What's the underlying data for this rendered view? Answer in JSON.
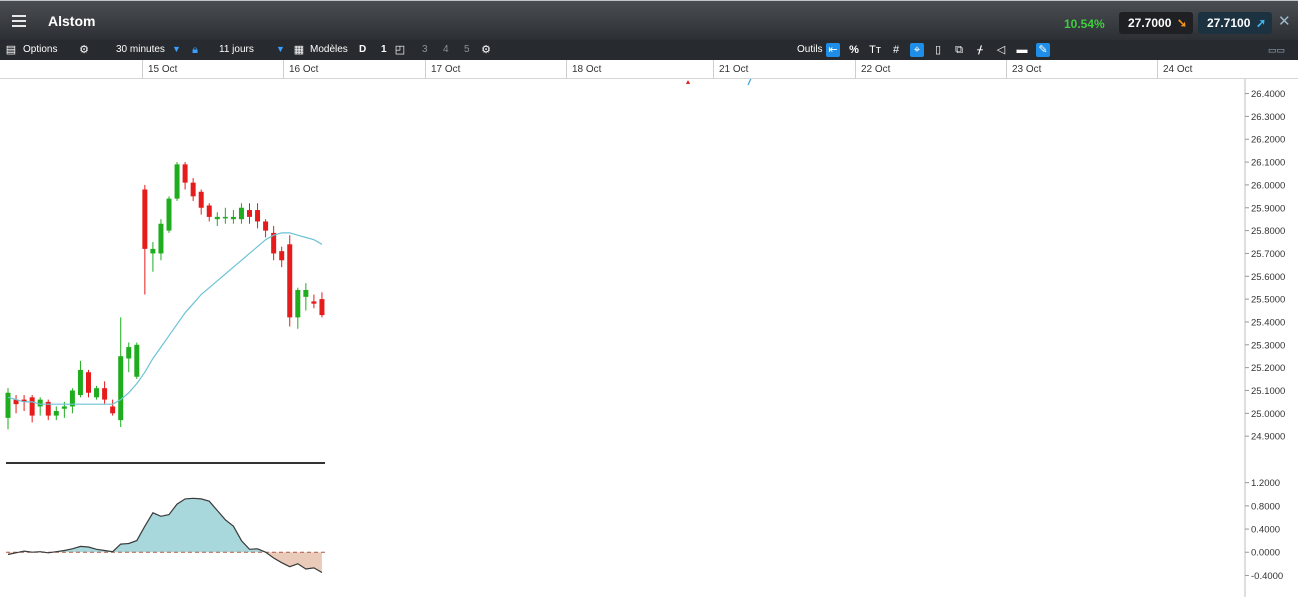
{
  "header": {
    "title": "Alstom",
    "change_pct": "10.54%",
    "bid": "27.7000",
    "ask": "27.7100"
  },
  "toolbar": {
    "options_label": "Options",
    "interval": "30 minutes",
    "range": "11 jours",
    "models_label": "Modèles",
    "d_label": "D",
    "n1": "1",
    "n3": "3",
    "n4": "4",
    "n5": "5",
    "tools_label": "Outils"
  },
  "dates": [
    "15 Oct",
    "16 Oct",
    "17 Oct",
    "18 Oct",
    "21 Oct",
    "22 Oct",
    "23 Oct",
    "24 Oct"
  ],
  "colors": {
    "up": "#1fad1f",
    "down": "#e61c1c",
    "ma": "#6cc3d6",
    "osc_pos": "#a8d8dc",
    "osc_neg": "#eacbb9"
  },
  "chart_data": {
    "type": "candlestick",
    "price_axis": {
      "ticks": [
        "26.4000",
        "26.3000",
        "26.2000",
        "26.1000",
        "26.0000",
        "25.9000",
        "25.8000",
        "25.7000",
        "25.6000",
        "25.5000",
        "25.4000",
        "25.3000",
        "25.2000",
        "25.1000",
        "25.0000",
        "24.9000"
      ],
      "ylim": [
        24.87,
        26.42
      ]
    },
    "osc_axis": {
      "ticks": [
        "1.2000",
        "0.8000",
        "0.4000",
        "0.0000",
        "-0.4000"
      ],
      "ylim": [
        -0.6,
        1.35
      ]
    },
    "candles": [
      {
        "o": 24.98,
        "h": 25.11,
        "l": 24.93,
        "c": 25.09
      },
      {
        "o": 25.06,
        "h": 25.08,
        "l": 25.0,
        "c": 25.04
      },
      {
        "o": 25.06,
        "h": 25.08,
        "l": 25.01,
        "c": 25.05
      },
      {
        "o": 25.07,
        "h": 25.08,
        "l": 24.96,
        "c": 24.99
      },
      {
        "o": 25.03,
        "h": 25.07,
        "l": 24.99,
        "c": 25.06
      },
      {
        "o": 25.05,
        "h": 25.06,
        "l": 24.97,
        "c": 24.99
      },
      {
        "o": 24.99,
        "h": 25.03,
        "l": 24.97,
        "c": 25.01
      },
      {
        "o": 25.02,
        "h": 25.05,
        "l": 24.98,
        "c": 25.03
      },
      {
        "o": 25.03,
        "h": 25.11,
        "l": 25.0,
        "c": 25.1
      },
      {
        "o": 25.08,
        "h": 25.23,
        "l": 25.07,
        "c": 25.19
      },
      {
        "o": 25.18,
        "h": 25.19,
        "l": 25.07,
        "c": 25.09
      },
      {
        "o": 25.07,
        "h": 25.12,
        "l": 25.06,
        "c": 25.11
      },
      {
        "o": 25.11,
        "h": 25.14,
        "l": 25.04,
        "c": 25.06
      },
      {
        "o": 25.03,
        "h": 25.06,
        "l": 24.99,
        "c": 25.0
      },
      {
        "o": 24.97,
        "h": 25.42,
        "l": 24.94,
        "c": 25.25
      },
      {
        "o": 25.24,
        "h": 25.31,
        "l": 25.18,
        "c": 25.29
      },
      {
        "o": 25.16,
        "h": 25.31,
        "l": 25.15,
        "c": 25.3
      },
      {
        "o": 25.98,
        "h": 26.0,
        "l": 25.52,
        "c": 25.72
      },
      {
        "o": 25.7,
        "h": 25.75,
        "l": 25.62,
        "c": 25.72
      },
      {
        "o": 25.7,
        "h": 25.85,
        "l": 25.67,
        "c": 25.83
      },
      {
        "o": 25.8,
        "h": 25.95,
        "l": 25.79,
        "c": 25.94
      },
      {
        "o": 25.94,
        "h": 26.1,
        "l": 25.93,
        "c": 26.09
      },
      {
        "o": 26.09,
        "h": 26.1,
        "l": 25.98,
        "c": 26.01
      },
      {
        "o": 26.01,
        "h": 26.03,
        "l": 25.93,
        "c": 25.95
      },
      {
        "o": 25.97,
        "h": 25.98,
        "l": 25.87,
        "c": 25.9
      },
      {
        "o": 25.91,
        "h": 25.92,
        "l": 25.84,
        "c": 25.86
      },
      {
        "o": 25.85,
        "h": 25.88,
        "l": 25.82,
        "c": 25.86
      },
      {
        "o": 25.86,
        "h": 25.9,
        "l": 25.83,
        "c": 25.86
      },
      {
        "o": 25.85,
        "h": 25.89,
        "l": 25.83,
        "c": 25.86
      },
      {
        "o": 25.85,
        "h": 25.92,
        "l": 25.83,
        "c": 25.9
      },
      {
        "o": 25.89,
        "h": 25.92,
        "l": 25.83,
        "c": 25.86
      },
      {
        "o": 25.89,
        "h": 25.92,
        "l": 25.81,
        "c": 25.84
      },
      {
        "o": 25.84,
        "h": 25.85,
        "l": 25.77,
        "c": 25.8
      },
      {
        "o": 25.79,
        "h": 25.82,
        "l": 25.67,
        "c": 25.7
      },
      {
        "o": 25.71,
        "h": 25.73,
        "l": 25.64,
        "c": 25.67
      },
      {
        "o": 25.74,
        "h": 25.78,
        "l": 25.38,
        "c": 25.42
      },
      {
        "o": 25.42,
        "h": 25.55,
        "l": 25.37,
        "c": 25.54
      },
      {
        "o": 25.51,
        "h": 25.57,
        "l": 25.45,
        "c": 25.54
      },
      {
        "o": 25.49,
        "h": 25.52,
        "l": 25.46,
        "c": 25.48
      },
      {
        "o": 25.5,
        "h": 25.53,
        "l": 25.42,
        "c": 25.43
      }
    ],
    "moving_average": [
      25.07,
      25.06,
      25.05,
      25.05,
      25.04,
      25.04,
      25.04,
      25.04,
      25.04,
      25.04,
      25.04,
      25.04,
      25.04,
      25.04,
      25.06,
      25.09,
      25.13,
      25.18,
      25.24,
      25.29,
      25.34,
      25.39,
      25.44,
      25.48,
      25.52,
      25.55,
      25.58,
      25.61,
      25.64,
      25.67,
      25.7,
      25.73,
      25.76,
      25.78,
      25.79,
      25.79,
      25.78,
      25.77,
      25.76,
      25.74
    ],
    "oscillator": [
      -0.04,
      -0.01,
      0.02,
      0.0,
      0.01,
      -0.01,
      0.01,
      0.03,
      0.06,
      0.1,
      0.09,
      0.05,
      0.03,
      0.01,
      0.14,
      0.15,
      0.2,
      0.45,
      0.68,
      0.62,
      0.65,
      0.83,
      0.92,
      0.93,
      0.92,
      0.88,
      0.72,
      0.56,
      0.45,
      0.2,
      0.05,
      0.06,
      0.0,
      -0.1,
      -0.18,
      -0.25,
      -0.2,
      -0.29,
      -0.27,
      -0.35
    ]
  }
}
